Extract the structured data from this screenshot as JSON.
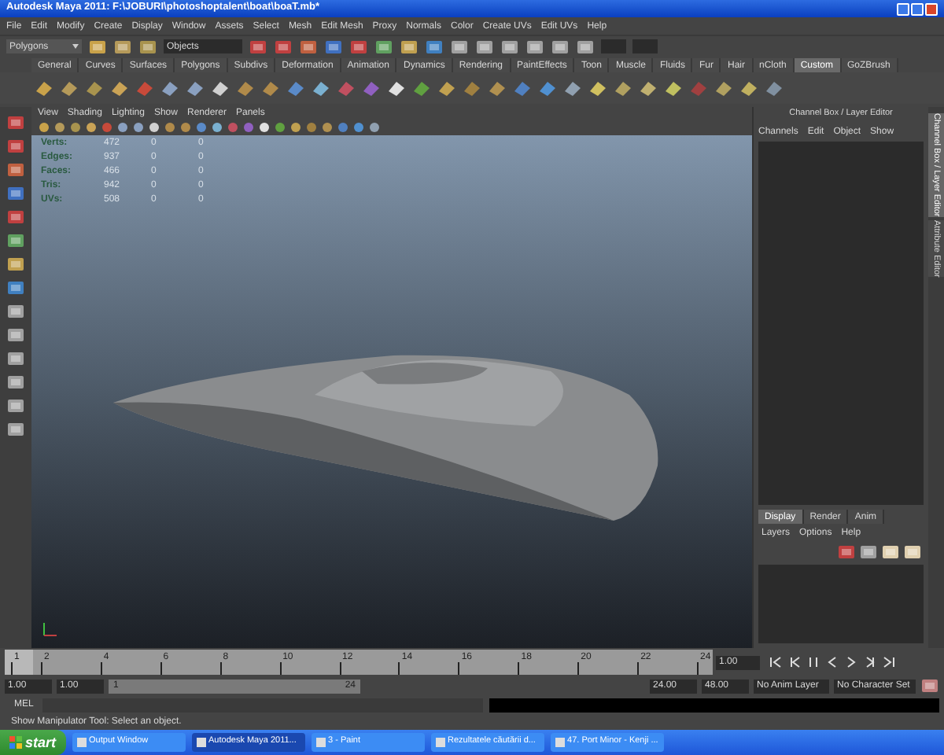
{
  "window": {
    "title": "Autodesk Maya 2011: F:\\JOBURI\\photoshoptalent\\boat\\boaT.mb*"
  },
  "menus": [
    "File",
    "Edit",
    "Modify",
    "Create",
    "Display",
    "Window",
    "Assets",
    "Select",
    "Mesh",
    "Edit Mesh",
    "Proxy",
    "Normals",
    "Color",
    "Create UVs",
    "Edit UVs",
    "Help"
  ],
  "status_line": {
    "mode": "Polygons",
    "selection_field": "Objects"
  },
  "shelf_tabs": [
    {
      "label": "General",
      "selected": false
    },
    {
      "label": "Curves",
      "selected": false
    },
    {
      "label": "Surfaces",
      "selected": false
    },
    {
      "label": "Polygons",
      "selected": false
    },
    {
      "label": "Subdivs",
      "selected": false
    },
    {
      "label": "Deformation",
      "selected": false
    },
    {
      "label": "Animation",
      "selected": false
    },
    {
      "label": "Dynamics",
      "selected": false
    },
    {
      "label": "Rendering",
      "selected": false
    },
    {
      "label": "PaintEffects",
      "selected": false
    },
    {
      "label": "Toon",
      "selected": false
    },
    {
      "label": "Muscle",
      "selected": false
    },
    {
      "label": "Fluids",
      "selected": false
    },
    {
      "label": "Fur",
      "selected": false
    },
    {
      "label": "Hair",
      "selected": false
    },
    {
      "label": "nCloth",
      "selected": false
    },
    {
      "label": "Custom",
      "selected": true
    },
    {
      "label": "GoZBrush",
      "selected": false
    }
  ],
  "viewport": {
    "menus": [
      "View",
      "Shading",
      "Lighting",
      "Show",
      "Renderer",
      "Panels"
    ],
    "stats": [
      {
        "label": "Verts:",
        "values": [
          "472",
          "0",
          "0"
        ]
      },
      {
        "label": "Edges:",
        "values": [
          "937",
          "0",
          "0"
        ]
      },
      {
        "label": "Faces:",
        "values": [
          "466",
          "0",
          "0"
        ]
      },
      {
        "label": "Tris:",
        "values": [
          "942",
          "0",
          "0"
        ]
      },
      {
        "label": "UVs:",
        "values": [
          "508",
          "0",
          "0"
        ]
      }
    ]
  },
  "channel_box": {
    "title": "Channel Box / Layer Editor",
    "menus": [
      "Channels",
      "Edit",
      "Object",
      "Show"
    ]
  },
  "layer_editor": {
    "tabs": [
      {
        "label": "Display",
        "selected": true
      },
      {
        "label": "Render",
        "selected": false
      },
      {
        "label": "Anim",
        "selected": false
      }
    ],
    "menus": [
      "Layers",
      "Options",
      "Help"
    ]
  },
  "side_tabs": [
    {
      "label": "Channel Box / Layer Editor",
      "selected": true
    },
    {
      "label": "Attribute Editor",
      "selected": false
    }
  ],
  "time_slider": {
    "labels": [
      "1",
      "2",
      "4",
      "6",
      "8",
      "10",
      "12",
      "14",
      "16",
      "18",
      "20",
      "22",
      "24"
    ],
    "current_frame": "1.00",
    "level": 0
  },
  "range_slider": {
    "start": "1.00",
    "playback_start": "1.00",
    "slider_start": "1",
    "level": 1,
    "slider_end": "24",
    "playback_end": "24.00",
    "end": "48.00",
    "anim_layer": "No Anim Layer",
    "character_set": "No Character Set"
  },
  "command_line": {
    "label": "MEL"
  },
  "help_line": "Show Manipulator Tool: Select an object.",
  "taskbar": {
    "start": "start",
    "items": [
      {
        "label": "Output Window",
        "selected": false
      },
      {
        "label": "Autodesk Maya 2011...",
        "selected": true
      },
      {
        "label": "3 - Paint",
        "selected": false
      },
      {
        "label": "Rezultatele căutării d...",
        "selected": false
      },
      {
        "label": "47. Port Minor - Kenji ...",
        "selected": false
      }
    ]
  }
}
